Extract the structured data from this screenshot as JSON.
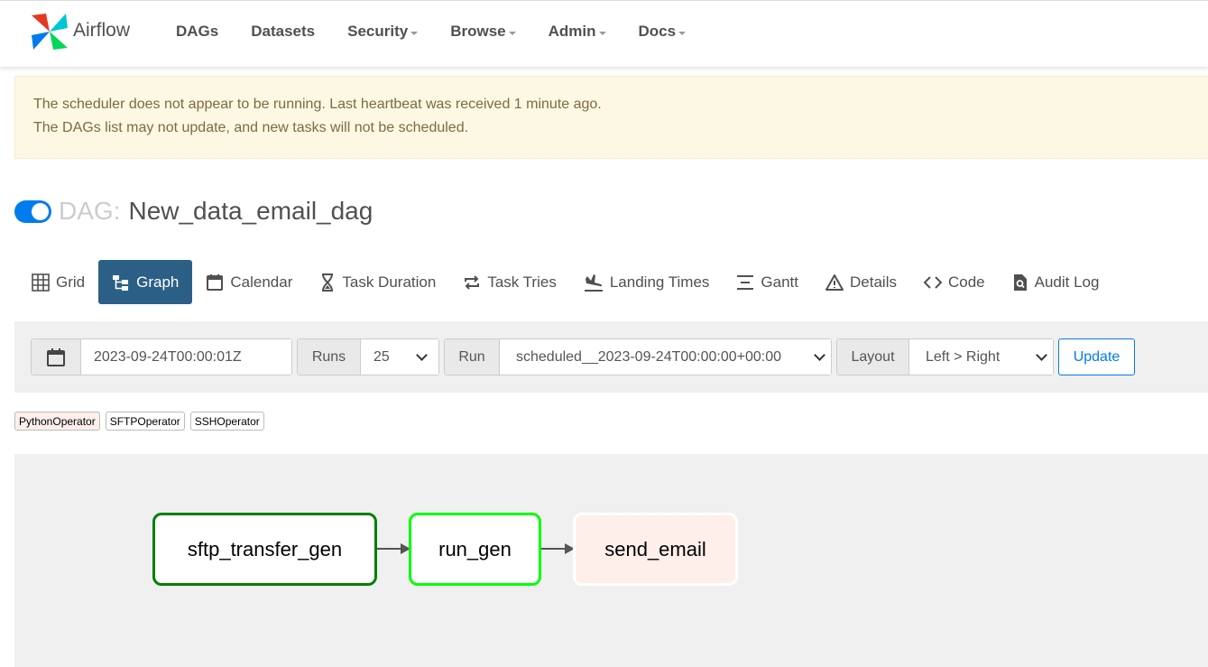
{
  "brand": {
    "name": "Airflow"
  },
  "nav": [
    {
      "label": "DAGs",
      "dropdown": false
    },
    {
      "label": "Datasets",
      "dropdown": false
    },
    {
      "label": "Security",
      "dropdown": true
    },
    {
      "label": "Browse",
      "dropdown": true
    },
    {
      "label": "Admin",
      "dropdown": true
    },
    {
      "label": "Docs",
      "dropdown": true
    }
  ],
  "alert": {
    "line1": "The scheduler does not appear to be running. Last heartbeat was received 1 minute ago.",
    "line2": "The DAGs list may not update, and new tasks will not be scheduled."
  },
  "dag": {
    "prefix": "DAG:",
    "name": "New_data_email_dag",
    "enabled": true
  },
  "tabs": [
    {
      "label": "Grid",
      "icon": "grid-icon",
      "active": false
    },
    {
      "label": "Graph",
      "icon": "graph-icon",
      "active": true
    },
    {
      "label": "Calendar",
      "icon": "calendar-icon",
      "active": false
    },
    {
      "label": "Task Duration",
      "icon": "hourglass-icon",
      "active": false
    },
    {
      "label": "Task Tries",
      "icon": "retry-icon",
      "active": false
    },
    {
      "label": "Landing Times",
      "icon": "plane-landing-icon",
      "active": false
    },
    {
      "label": "Gantt",
      "icon": "gantt-icon",
      "active": false
    },
    {
      "label": "Details",
      "icon": "warning-triangle-icon",
      "active": false
    },
    {
      "label": "Code",
      "icon": "code-icon",
      "active": false
    },
    {
      "label": "Audit Log",
      "icon": "audit-log-icon",
      "active": false
    }
  ],
  "filters": {
    "date": "2023-09-24T00:00:01Z",
    "runs_label": "Runs",
    "runs_value": "25",
    "run_label": "Run",
    "run_value": "scheduled__2023-09-24T00:00:00+00:00",
    "layout_label": "Layout",
    "layout_value": "Left > Right",
    "update_label": "Update"
  },
  "legend": [
    {
      "label": "PythonOperator",
      "color": "#ffefeb"
    },
    {
      "label": "SFTPOperator",
      "color": "#ffffff"
    },
    {
      "label": "SSHOperator",
      "color": "#ffffff"
    }
  ],
  "graph": {
    "nodes": [
      {
        "id": "sftp_transfer_gen",
        "state_color": "#008000",
        "fill": "#ffffff"
      },
      {
        "id": "run_gen",
        "state_color": "#00ff00",
        "fill": "#ffffff"
      },
      {
        "id": "send_email",
        "state_color": "#ffffff",
        "fill": "#ffefeb"
      }
    ]
  }
}
